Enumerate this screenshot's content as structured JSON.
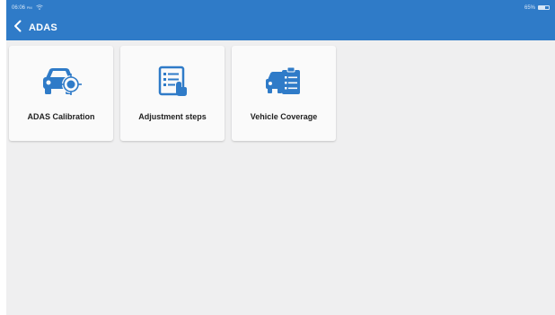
{
  "status_bar": {
    "time": "06:06",
    "ampm": "PM",
    "battery": "65%",
    "battery_level": 0.65
  },
  "app_bar": {
    "title": "ADAS"
  },
  "tiles": [
    {
      "label": "ADAS Calibration",
      "icon": "car-calibration-icon"
    },
    {
      "label": "Adjustment steps",
      "icon": "checklist-icon"
    },
    {
      "label": "Vehicle Coverage",
      "icon": "vehicle-coverage-icon"
    }
  ],
  "colors": {
    "primary": "#2f7bc8",
    "background": "#efeff0",
    "tile": "#fafafa"
  }
}
